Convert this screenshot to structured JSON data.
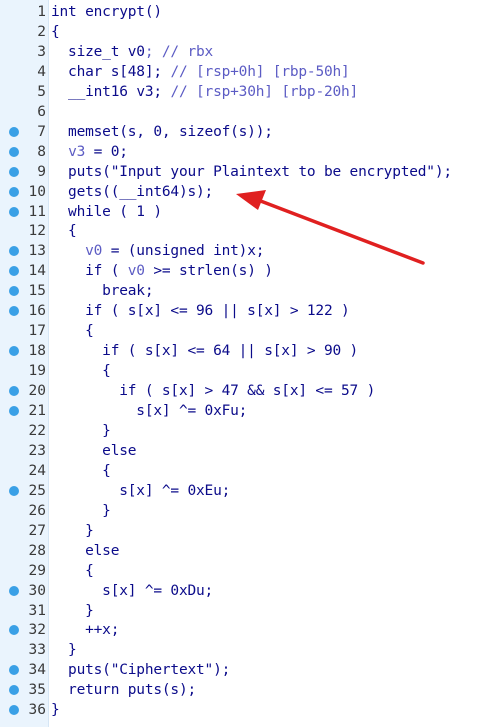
{
  "editor": {
    "lines": [
      {
        "num": "1",
        "bp": false,
        "tokens": [
          {
            "t": "int encrypt()",
            "c": "k"
          }
        ]
      },
      {
        "num": "2",
        "bp": false,
        "tokens": [
          {
            "t": "{",
            "c": "k"
          }
        ]
      },
      {
        "num": "3",
        "bp": false,
        "tokens": [
          {
            "t": "  size_t ",
            "c": "k"
          },
          {
            "t": "v0",
            "c": "k"
          },
          {
            "t": "; // rbx",
            "c": "c"
          }
        ]
      },
      {
        "num": "4",
        "bp": false,
        "tokens": [
          {
            "t": "  char ",
            "c": "k"
          },
          {
            "t": "s",
            "c": "k"
          },
          {
            "t": "[48]; ",
            "c": "k"
          },
          {
            "t": "// [rsp+0h] [rbp-50h]",
            "c": "c"
          }
        ]
      },
      {
        "num": "5",
        "bp": false,
        "tokens": [
          {
            "t": "  __int16 ",
            "c": "k"
          },
          {
            "t": "v3",
            "c": "k"
          },
          {
            "t": "; ",
            "c": "k"
          },
          {
            "t": "// [rsp+30h] [rbp-20h]",
            "c": "c"
          }
        ]
      },
      {
        "num": "6",
        "bp": false,
        "tokens": []
      },
      {
        "num": "7",
        "bp": true,
        "tokens": [
          {
            "t": "  memset(s, 0, sizeof(s));",
            "c": "k"
          }
        ]
      },
      {
        "num": "8",
        "bp": true,
        "tokens": [
          {
            "t": "  ",
            "c": "k"
          },
          {
            "t": "v3",
            "c": "v"
          },
          {
            "t": " = 0;",
            "c": "k"
          }
        ]
      },
      {
        "num": "9",
        "bp": true,
        "tokens": [
          {
            "t": "  puts(\"Input your Plaintext to be encrypted\");",
            "c": "s"
          }
        ]
      },
      {
        "num": "10",
        "bp": true,
        "tokens": [
          {
            "t": "  gets((__int64)s);",
            "c": "k"
          }
        ]
      },
      {
        "num": "11",
        "bp": true,
        "tokens": [
          {
            "t": "  while ( 1 )",
            "c": "k"
          }
        ]
      },
      {
        "num": "12",
        "bp": false,
        "tokens": [
          {
            "t": "  {",
            "c": "k"
          }
        ]
      },
      {
        "num": "13",
        "bp": true,
        "tokens": [
          {
            "t": "    ",
            "c": "k"
          },
          {
            "t": "v0",
            "c": "v"
          },
          {
            "t": " = (unsigned int)x;",
            "c": "k"
          }
        ]
      },
      {
        "num": "14",
        "bp": true,
        "tokens": [
          {
            "t": "    if ( ",
            "c": "k"
          },
          {
            "t": "v0",
            "c": "v"
          },
          {
            "t": " >= strlen(s) )",
            "c": "k"
          }
        ]
      },
      {
        "num": "15",
        "bp": true,
        "tokens": [
          {
            "t": "      break;",
            "c": "k"
          }
        ]
      },
      {
        "num": "16",
        "bp": true,
        "tokens": [
          {
            "t": "    if ( s[x] <= 96 || s[x] > 122 )",
            "c": "k"
          }
        ]
      },
      {
        "num": "17",
        "bp": false,
        "tokens": [
          {
            "t": "    {",
            "c": "k"
          }
        ]
      },
      {
        "num": "18",
        "bp": true,
        "tokens": [
          {
            "t": "      if ( s[x] <= 64 || s[x] > 90 )",
            "c": "k"
          }
        ]
      },
      {
        "num": "19",
        "bp": false,
        "tokens": [
          {
            "t": "      {",
            "c": "k"
          }
        ]
      },
      {
        "num": "20",
        "bp": true,
        "tokens": [
          {
            "t": "        if ( s[x] > 47 && s[x] <= 57 )",
            "c": "k"
          }
        ]
      },
      {
        "num": "21",
        "bp": true,
        "tokens": [
          {
            "t": "          s[x] ^= 0xFu;",
            "c": "k"
          }
        ]
      },
      {
        "num": "22",
        "bp": false,
        "tokens": [
          {
            "t": "      }",
            "c": "k"
          }
        ]
      },
      {
        "num": "23",
        "bp": false,
        "tokens": [
          {
            "t": "      else",
            "c": "k"
          }
        ]
      },
      {
        "num": "24",
        "bp": false,
        "tokens": [
          {
            "t": "      {",
            "c": "k"
          }
        ]
      },
      {
        "num": "25",
        "bp": true,
        "tokens": [
          {
            "t": "        s[x] ^= 0xEu;",
            "c": "k"
          }
        ]
      },
      {
        "num": "26",
        "bp": false,
        "tokens": [
          {
            "t": "      }",
            "c": "k"
          }
        ]
      },
      {
        "num": "27",
        "bp": false,
        "tokens": [
          {
            "t": "    }",
            "c": "k"
          }
        ]
      },
      {
        "num": "28",
        "bp": false,
        "tokens": [
          {
            "t": "    else",
            "c": "k"
          }
        ]
      },
      {
        "num": "29",
        "bp": false,
        "tokens": [
          {
            "t": "    {",
            "c": "k"
          }
        ]
      },
      {
        "num": "30",
        "bp": true,
        "tokens": [
          {
            "t": "      s[x] ^= 0xDu;",
            "c": "k"
          }
        ]
      },
      {
        "num": "31",
        "bp": false,
        "tokens": [
          {
            "t": "    }",
            "c": "k"
          }
        ]
      },
      {
        "num": "32",
        "bp": true,
        "tokens": [
          {
            "t": "    ++x;",
            "c": "k"
          }
        ]
      },
      {
        "num": "33",
        "bp": false,
        "tokens": [
          {
            "t": "  }",
            "c": "k"
          }
        ]
      },
      {
        "num": "34",
        "bp": true,
        "tokens": [
          {
            "t": "  puts(\"Ciphertext\");",
            "c": "s"
          }
        ]
      },
      {
        "num": "35",
        "bp": true,
        "tokens": [
          {
            "t": "  return puts(s);",
            "c": "k"
          }
        ]
      },
      {
        "num": "36",
        "bp": true,
        "tokens": [
          {
            "t": "}",
            "c": "k"
          }
        ]
      }
    ]
  },
  "annotation": {
    "arrow_target_line": "10",
    "arrow_color": "#e02020"
  },
  "colors": {
    "gutter_bg": "#eaf4fd",
    "breakpoint": "#3aa0e6",
    "code_text": "#0b0b8a",
    "variable_text": "#5c5cc4"
  }
}
